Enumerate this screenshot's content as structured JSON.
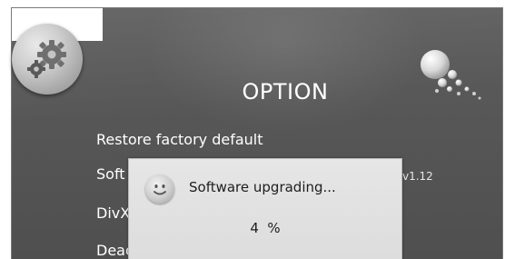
{
  "screen": {
    "title": "OPTION",
    "icon": "gear-icon",
    "decoration": "bubbles-icon"
  },
  "menu": {
    "items": [
      {
        "label": "Restore factory default"
      },
      {
        "label": "Soft"
      },
      {
        "label": "DivX"
      },
      {
        "label": "Deac"
      }
    ],
    "version": "v1.12"
  },
  "dialog": {
    "icon": "smiley-icon",
    "message": "Software upgrading...",
    "progress_text": "4  %",
    "progress_percent": 4
  },
  "colors": {
    "background": "#575757",
    "text": "#ffffff",
    "dialog_background": "#e0e0e0",
    "dialog_text": "#1e1e1e"
  }
}
